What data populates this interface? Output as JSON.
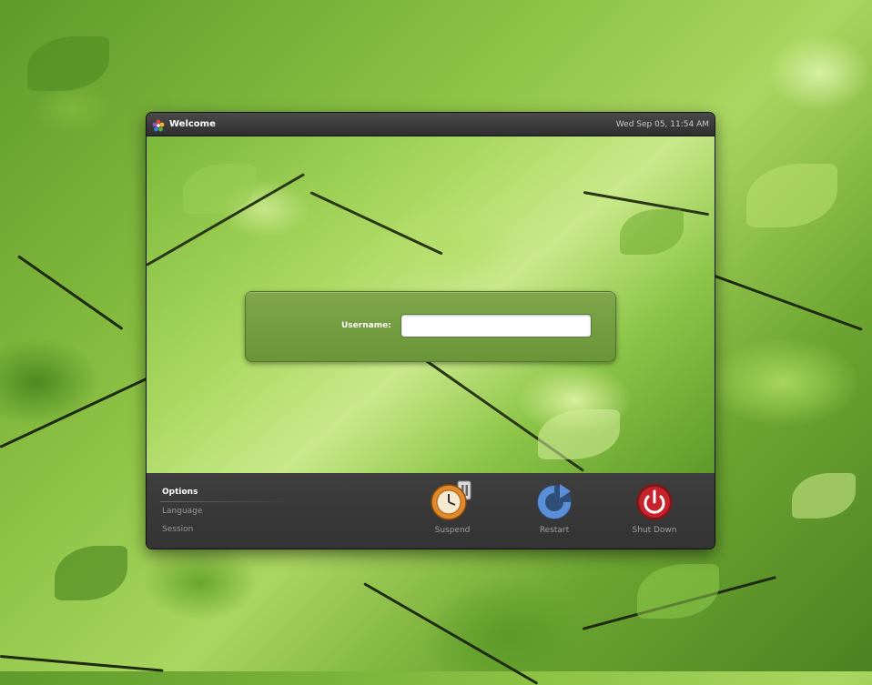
{
  "window": {
    "title": "Welcome",
    "clock": "Wed Sep 05, 11:54 AM"
  },
  "login": {
    "username_label": "Username:",
    "username_value": ""
  },
  "options": {
    "heading": "Options",
    "language": "Language",
    "session": "Session"
  },
  "actions": {
    "suspend": "Suspend",
    "restart": "Restart",
    "shutdown": "Shut Down"
  },
  "icons": {
    "title_logo": "gnome-flower-icon",
    "suspend": "suspend-clock-icon",
    "restart": "restart-arrow-icon",
    "shutdown": "power-icon"
  },
  "colors": {
    "panel_green": "#6a9538",
    "suspend_orange": "#e08a2a",
    "restart_blue": "#3f6fb8",
    "shutdown_red": "#c8232c"
  }
}
